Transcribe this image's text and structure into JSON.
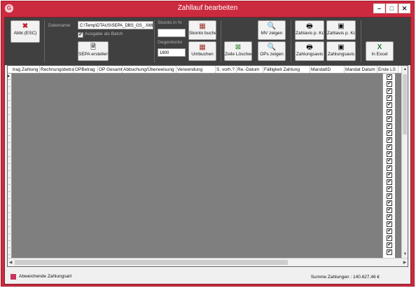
{
  "window": {
    "title": "Zahllauf bearbeiten",
    "minimize": "–",
    "maximize": "□",
    "close": "✕"
  },
  "toolbar": {
    "abbr_label": "Abbr.(ESC)",
    "dateiname_label": "Dateiname",
    "dateiname_value": "C:\\Temp\\DTAUS\\SEPA_DBS_GS_.XML",
    "ausgabe_batch": "Ausgabe als Batch",
    "sepa_label": "SEPA erstellen",
    "skonto_label": "Skonto in %",
    "skonto_value": "",
    "gegenkonto_label": "Gegenkonto",
    "gegenkonto_value": "1800",
    "skonto_buchen": "Skonto buchen",
    "umbuchen": "Umbuchen",
    "zeile_loeschen": "Zeile Löschen",
    "mv_zeigen": "MV zeigen",
    "ops_zeigen": "OPs zeigen",
    "zahlavis_pkd_1": "Zahlavis p. Kd",
    "zahlavis_pkd_2": "Zahlavis p. Kd",
    "zahlungsavis_1": "Zahlungsavis",
    "zahlungsavis_2": "Zahlungsavis",
    "in_excel": "In Excel"
  },
  "grid": {
    "columns": [
      "trag Zahlung",
      "Rechnungsbetrag",
      "OPBetrag",
      "OP Gesamt",
      "Abbuchung/Überweisung",
      "Verwendung",
      "S. vorh.?",
      "Re.-Datum",
      "Fälligkeit Zahlung",
      "MandatID",
      "Mandat Datum",
      "Erste LS"
    ],
    "erste_ls_checked": true,
    "row_count": 26
  },
  "status": {
    "legend": "Abweichende Zahlungsart",
    "summe": "Summe Zahlungen : 140.627,46 €"
  },
  "colors": {
    "accent": "#cc2b3f",
    "toolbar_bg": "#404040",
    "grid_bg": "#7f7f7f",
    "legend": "#c8345a"
  }
}
